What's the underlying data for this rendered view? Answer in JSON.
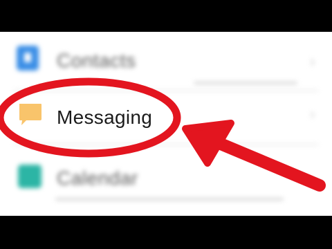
{
  "settings_list": {
    "items": [
      {
        "label": "Contacts",
        "icon": "contacts-icon",
        "icon_color": "#3a8ee6"
      },
      {
        "label": "Messaging",
        "icon": "messaging-icon",
        "icon_color": "#f9c46b"
      },
      {
        "label": "Calendar",
        "icon": "calendar-icon",
        "icon_color": "#2cb5a5"
      }
    ]
  },
  "annotation": {
    "highlight_color": "#e3151f",
    "arrow_color": "#e3151f"
  }
}
